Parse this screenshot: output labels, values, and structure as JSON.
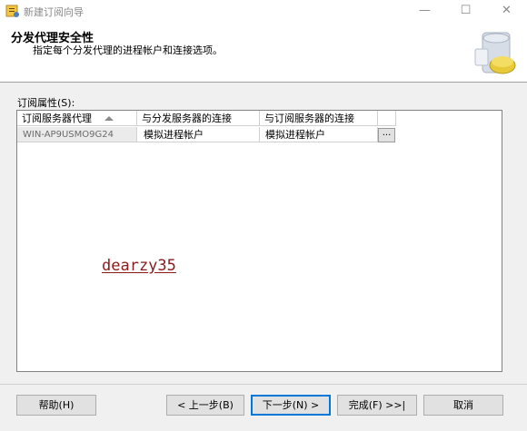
{
  "window": {
    "title": "新建订阅向导",
    "controls": {
      "minimize": "—",
      "maximize": "☐",
      "close": "✕"
    }
  },
  "header": {
    "title": "分发代理安全性",
    "subtitle": "指定每个分发代理的进程帐户和连接选项。"
  },
  "grid": {
    "label": "订阅属性(S):",
    "columns": [
      "订阅服务器代理",
      "与分发服务器的连接",
      "与订阅服务器的连接",
      ""
    ],
    "rows": [
      {
        "agent": "WIN-AP9USMO9G24",
        "distributor_conn": "模拟进程帐户",
        "subscriber_conn": "模拟进程帐户",
        "action": "..."
      }
    ]
  },
  "watermark": "dearzy35",
  "buttons": {
    "help": "帮助(H)",
    "back": "< 上一步(B)",
    "next": "下一步(N) >",
    "finish": "完成(F) >>|",
    "cancel": "取消"
  },
  "colors": {
    "accent": "#0078d7",
    "watermark": "#8b1a1a"
  }
}
